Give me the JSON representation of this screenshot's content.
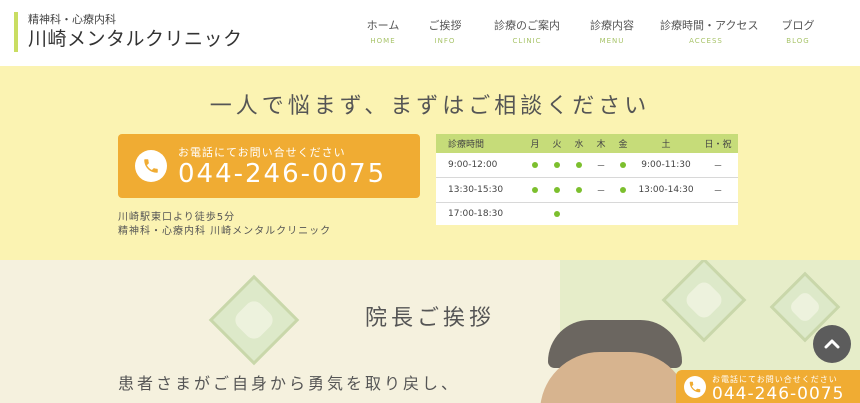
{
  "header": {
    "logo_sub": "精神科・心療内科",
    "logo_main": "川崎メンタルクリニック"
  },
  "nav": [
    {
      "jp": "ホーム",
      "en": "HOME"
    },
    {
      "jp": "ご挨拶",
      "en": "INFO"
    },
    {
      "jp": "診療のご案内",
      "en": "CLINIC"
    },
    {
      "jp": "診療内容",
      "en": "MENU"
    },
    {
      "jp": "診療時間・アクセス",
      "en": "ACCESS"
    },
    {
      "jp": "ブログ",
      "en": "BLOG"
    }
  ],
  "consult": {
    "title": "一人で悩まず、まずはご相談ください",
    "phone_label": "お電話にてお問い合せください",
    "phone_number": "044-246-0075",
    "access_1": "川崎駅東口より徒歩5分",
    "access_2": "精神科・心療内科 川崎メンタルクリニック"
  },
  "hours": {
    "headers": [
      "診療時間",
      "月",
      "火",
      "水",
      "木",
      "金",
      "土",
      "日・祝"
    ],
    "rows": [
      {
        "time": "9:00-12:00",
        "mon": "●",
        "tue": "●",
        "wed": "●",
        "thu": "－",
        "fri": "●",
        "sat": "9:00-11:30",
        "sun": "－"
      },
      {
        "time": "13:30-15:30",
        "mon": "●",
        "tue": "●",
        "wed": "●",
        "thu": "－",
        "fri": "●",
        "sat": "13:00-14:30",
        "sun": "－"
      },
      {
        "time": "17:00-18:30",
        "mon": "",
        "tue": "●",
        "wed": "",
        "thu": "",
        "fri": "",
        "sat": "",
        "sun": ""
      }
    ]
  },
  "greeting": {
    "title": "院長ご挨拶",
    "text": "患者さまがご自身から勇気を取り戻し、"
  },
  "float_phone": {
    "label": "お電話にてお問い合せください",
    "number": "044-246-0075"
  },
  "colors": {
    "accent_green": "#c9dd62",
    "band_yellow": "#fbf3b2",
    "phone_orange": "#f0ac33",
    "dot_green": "#7cbf2e"
  }
}
